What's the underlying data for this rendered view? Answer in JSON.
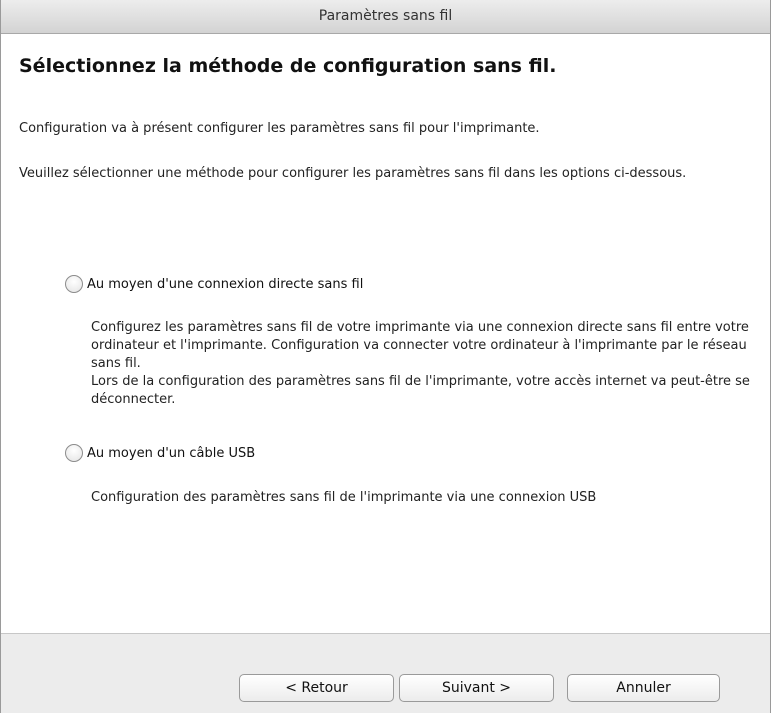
{
  "window": {
    "title": "Paramètres sans fil"
  },
  "main": {
    "heading": "Sélectionnez la méthode de configuration sans fil.",
    "intro": "Configuration va à présent configurer les paramètres sans fil pour l'imprimante.",
    "instruction": "Veuillez sélectionner une méthode pour configurer les paramètres sans fil dans les options ci-dessous.",
    "options": [
      {
        "label": "Au moyen d'une connexion directe sans fil",
        "selected": false,
        "description": [
          "Configurez les paramètres sans fil de votre imprimante via une connexion directe sans fil entre votre ordinateur et l'imprimante. Configuration va connecter votre ordinateur à l'imprimante par le réseau sans fil.",
          "Lors de la configuration des paramètres sans fil de l'imprimante, votre accès internet va peut-être se déconnecter."
        ]
      },
      {
        "label": "Au moyen d'un câble USB",
        "selected": false,
        "description": [
          "Configuration des paramètres sans fil de l'imprimante via une connexion USB"
        ]
      }
    ]
  },
  "footer": {
    "back_label": "< Retour",
    "next_label": "Suivant >",
    "cancel_label": "Annuler"
  }
}
